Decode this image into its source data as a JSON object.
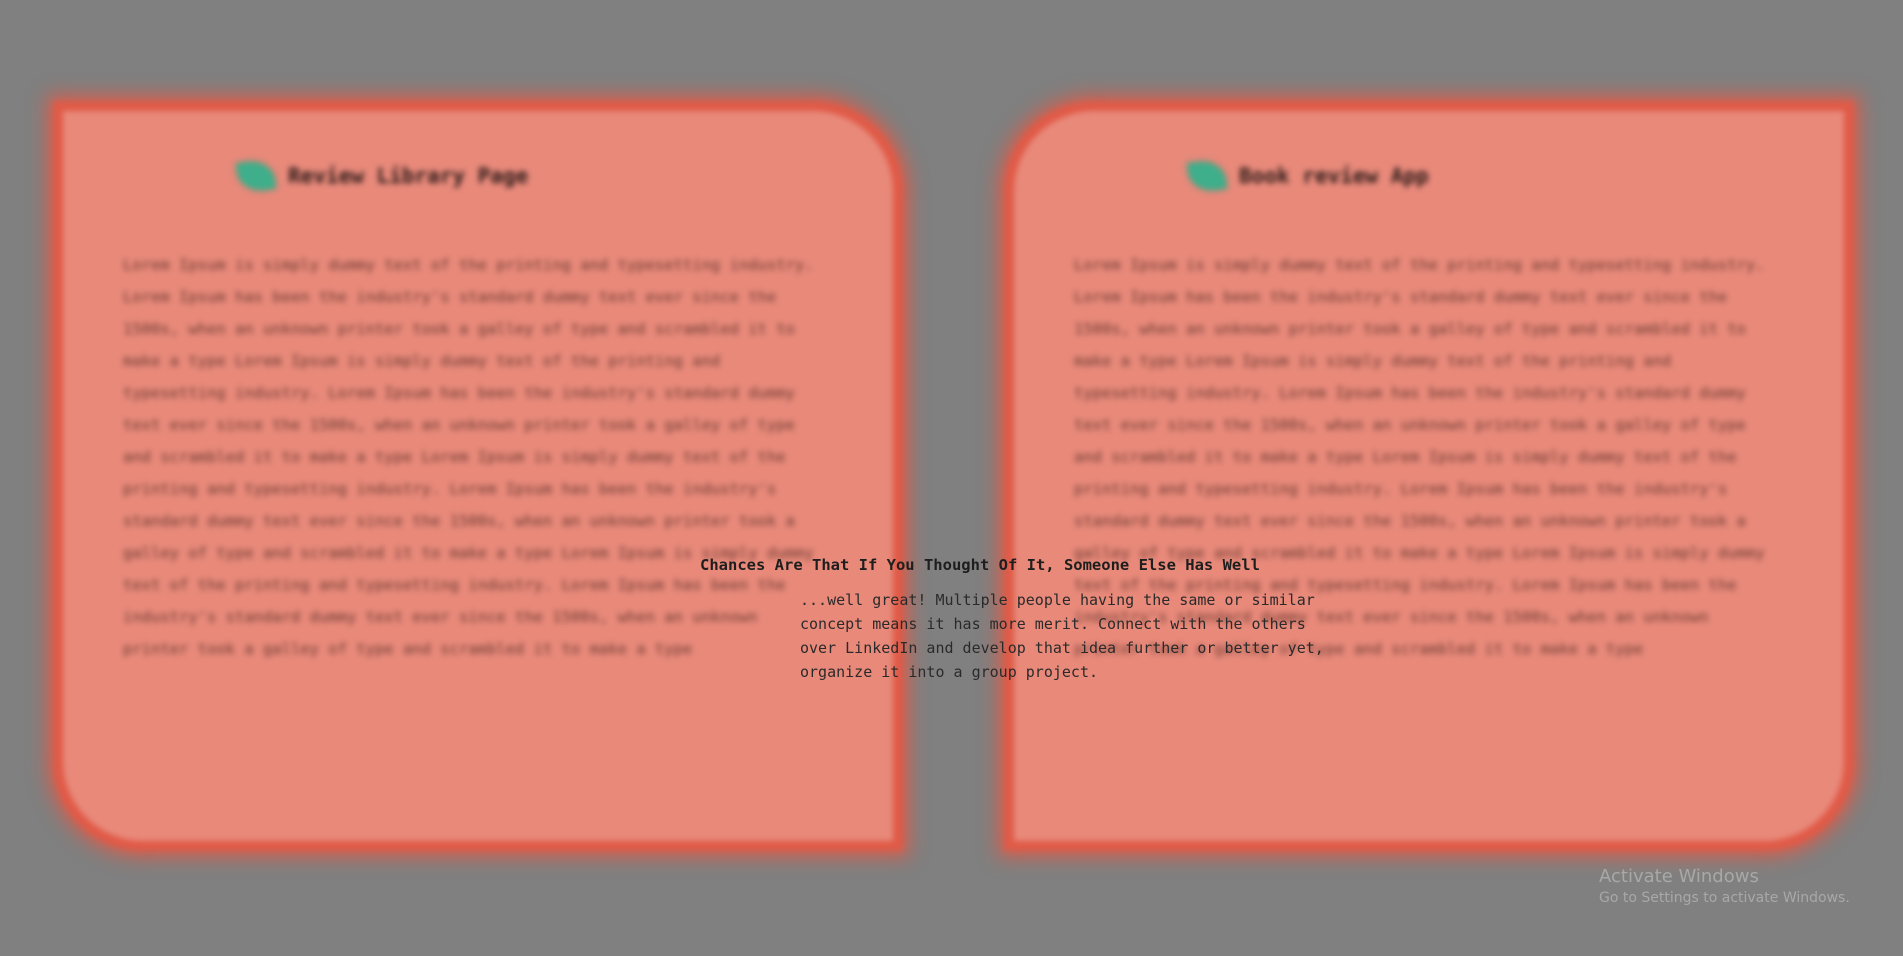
{
  "cards": [
    {
      "title": "Review Library Page",
      "body": "Lorem Ipsum is simply dummy text of the printing and typesetting industry. Lorem Ipsum has been the industry's standard dummy text ever since the 1500s, when an unknown printer took a galley of type and scrambled it to make a type Lorem Ipsum is simply dummy text of the printing and typesetting industry. Lorem Ipsum has been the industry's standard dummy text ever since the 1500s, when an unknown printer took a galley of type and scrambled it to make a type Lorem Ipsum is simply dummy text of the printing and typesetting industry. Lorem Ipsum has been the industry's standard dummy text ever since the 1500s, when an unknown printer took a galley of type and scrambled it to make a type Lorem Ipsum is simply dummy text of the printing and typesetting industry. Lorem Ipsum has been the industry's standard dummy text ever since the 1500s, when an unknown printer took a galley of type and scrambled it to make a type"
    },
    {
      "title": "Book review App",
      "body": "Lorem Ipsum is simply dummy text of the printing and typesetting industry. Lorem Ipsum has been the industry's standard dummy text ever since the 1500s, when an unknown printer took a galley of type and scrambled it to make a type Lorem Ipsum is simply dummy text of the printing and typesetting industry. Lorem Ipsum has been the industry's standard dummy text ever since the 1500s, when an unknown printer took a galley of type and scrambled it to make a type Lorem Ipsum is simply dummy text of the printing and typesetting industry. Lorem Ipsum has been the industry's standard dummy text ever since the 1500s, when an unknown printer took a galley of type and scrambled it to make a type Lorem Ipsum is simply dummy text of the printing and typesetting industry. Lorem Ipsum has been the industry's standard dummy text ever since the 1500s, when an unknown printer took a galley of type and scrambled it to make a type"
    }
  ],
  "overlay": {
    "title": "Chances Are That If You Thought Of It, Someone Else Has Well",
    "text": "...well great! Multiple people having the same or similar concept means it has more merit. Connect with the others over LinkedIn and develop that idea further or better yet, organize it into a group project."
  },
  "watermark": {
    "title": "Activate Windows",
    "subtitle": "Go to Settings to activate Windows."
  },
  "colors": {
    "background": "#808080",
    "card_fill": "#e8897a",
    "card_border": "#e05a47",
    "leaf": "#3fae8a"
  },
  "icons": [
    "leaf-icon"
  ]
}
